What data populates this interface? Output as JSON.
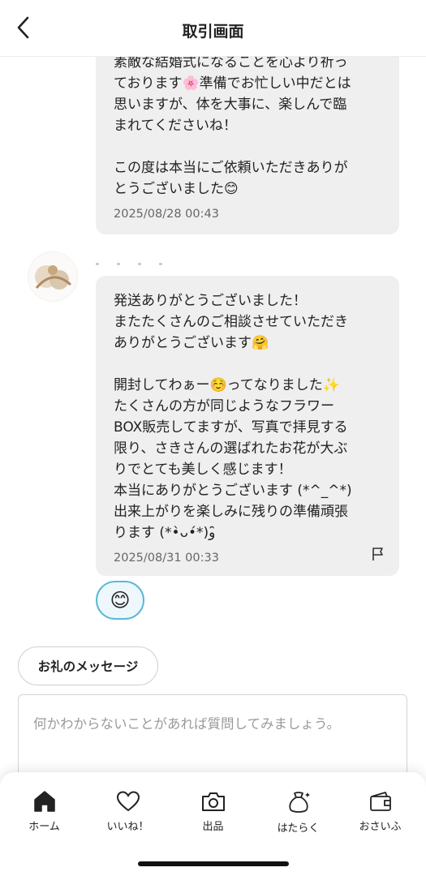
{
  "header": {
    "title": "取引画面",
    "back_icon": "chevron-left-icon"
  },
  "messages": [
    {
      "lines": [
        "素敵な結婚式になることを心より祈っ",
        "ております🌸準備でお忙しい中だとは",
        "思いますが、体を大事に、楽しんで臨",
        "まれてくださいね！",
        "",
        "この度は本当にご依頼いただきありが",
        "とうございました😊"
      ],
      "timestamp": "2025/08/28 00:43"
    },
    {
      "lines": [
        "発送ありがとうございました！",
        "またたくさんのご相談させていただき",
        "ありがとうございます🤗",
        "",
        "開封してわぁー☺️ってなりました✨",
        "たくさんの方が同じようなフラワー",
        "BOX販売してますが、写真で拝見する",
        "限り、さきさんの選ばれたお花が大ぶ",
        "りでとても美しく感じます！",
        "本当にありがとうございます (*^_^*)",
        "出来上がりを楽しみに残りの準備頑張",
        "ります (*•̀ᴗ•́*)و ̑̑"
      ],
      "timestamp": "2025/08/31 00:33",
      "reaction": "😊"
    }
  ],
  "thanks_button": {
    "label": "お礼のメッセージ"
  },
  "input": {
    "placeholder": "何かわからないことがあれば質問してみましょう。"
  },
  "tabbar": {
    "items": [
      {
        "label": "ホーム",
        "icon": "home-icon"
      },
      {
        "label": "いいね！",
        "icon": "heart-icon"
      },
      {
        "label": "出品",
        "icon": "camera-icon"
      },
      {
        "label": "はたらく",
        "icon": "money-bag-icon"
      },
      {
        "label": "おさいふ",
        "icon": "wallet-icon"
      }
    ]
  },
  "colors": {
    "bubble": "#efefef",
    "reaction_border": "#5cb8d6",
    "text": "#222222",
    "timestamp": "#666666"
  }
}
